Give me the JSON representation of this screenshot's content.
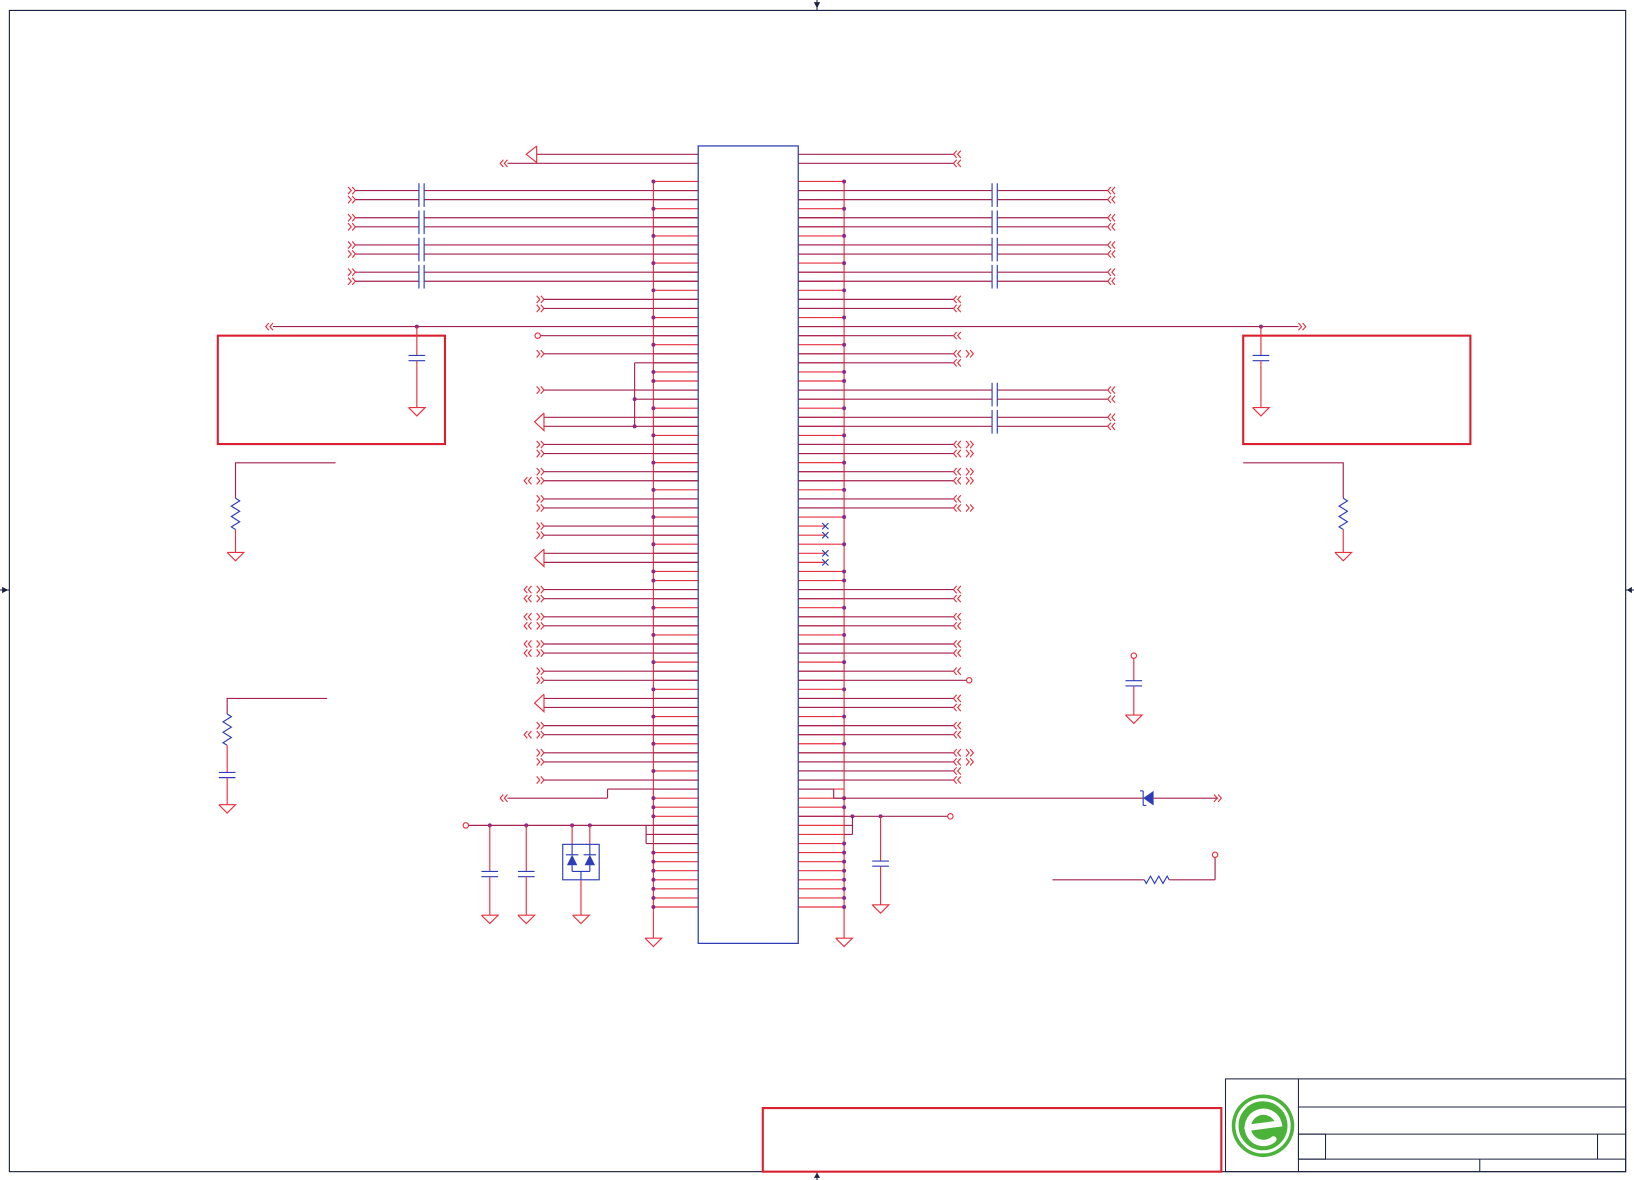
{
  "colors": {
    "wire": "#e8303f",
    "net": "#a3224f",
    "component": "#2d3db8",
    "junction": "#8a2a86",
    "frame": "#1c2340",
    "box": "#d91e2e",
    "logo": "#4bb33a",
    "background": "#ffffff"
  },
  "icons": {
    "logo": "green-e-logo-icon",
    "ground": "ground-icon",
    "connector": "off-page-connector-icon",
    "capacitor": "capacitor-symbol",
    "resistor": "resistor-symbol",
    "diode": "zener-diode-symbol",
    "no_connect": "no-connect-icon"
  }
}
